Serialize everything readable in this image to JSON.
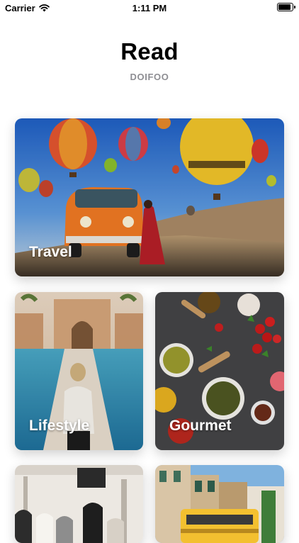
{
  "status_bar": {
    "carrier": "Carrier",
    "time": "1:11 PM"
  },
  "header": {
    "title": "Read",
    "subtitle": "DOIFOO"
  },
  "categories": [
    {
      "label": "Travel"
    },
    {
      "label": "Lifestyle"
    },
    {
      "label": "Gourmet"
    },
    {
      "label": ""
    },
    {
      "label": ""
    }
  ]
}
